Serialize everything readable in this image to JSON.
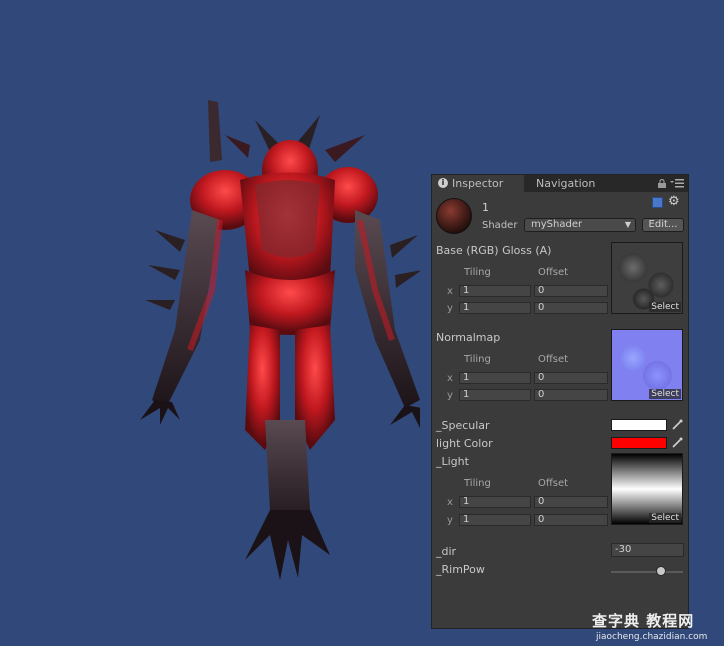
{
  "tabs": {
    "inspector": "Inspector",
    "navigation": "Navigation"
  },
  "icons": {
    "info": "info-icon",
    "lock": "lock-icon",
    "menu": "menu-icon",
    "help": "help-icon",
    "gear": "gear-icon",
    "picker": "eyedropper-icon"
  },
  "material": {
    "name": "1",
    "shader_label": "Shader",
    "shader_value": "myShader",
    "edit_label": "Edit..."
  },
  "base_section": {
    "label": "Base (RGB) Gloss (A)",
    "tiling_label": "Tiling",
    "offset_label": "Offset",
    "x_label": "x",
    "y_label": "y",
    "tiling_x": "1",
    "offset_x": "0",
    "tiling_y": "1",
    "offset_y": "0",
    "select_label": "Select"
  },
  "normal_section": {
    "label": "Normalmap",
    "tiling_label": "Tiling",
    "offset_label": "Offset",
    "x_label": "x",
    "y_label": "y",
    "tiling_x": "1",
    "offset_x": "0",
    "tiling_y": "1",
    "offset_y": "0",
    "select_label": "Select"
  },
  "colors": {
    "specular_label": "_Specular",
    "specular_color": "#ffffff",
    "light_color_label": "light Color",
    "light_color": "#ff0000"
  },
  "light_section": {
    "label": "_Light",
    "tiling_label": "Tiling",
    "offset_label": "Offset",
    "x_label": "x",
    "y_label": "y",
    "tiling_x": "1",
    "offset_x": "0",
    "tiling_y": "1",
    "offset_y": "0",
    "select_label": "Select"
  },
  "dir": {
    "label": "_dir",
    "value": "-30"
  },
  "rimpow": {
    "label": "_RimPow",
    "slider_fraction": 0.7
  },
  "watermark": {
    "main": "查字典 教程网",
    "sub": "jiaocheng.chazidian.com"
  }
}
